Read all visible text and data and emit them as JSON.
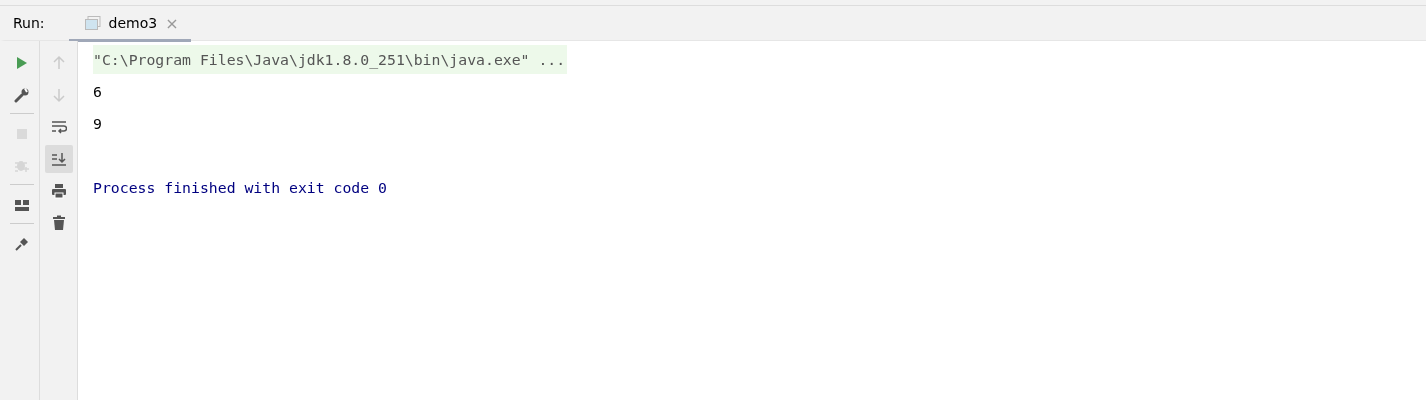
{
  "panel": {
    "label": "Run:"
  },
  "tabs": [
    {
      "label": "demo3",
      "selected": true,
      "close": "×"
    }
  ],
  "left_toolbar": [
    [
      {
        "kind": "run",
        "disabled": false
      },
      {
        "kind": "wrench",
        "disabled": false
      }
    ],
    [
      {
        "kind": "stop",
        "disabled": true
      },
      {
        "kind": "debug",
        "disabled": true
      }
    ],
    [
      {
        "kind": "layout",
        "disabled": false
      }
    ],
    [
      {
        "kind": "pin",
        "disabled": false
      }
    ]
  ],
  "console_toolbar": [
    {
      "kind": "up",
      "disabled": true,
      "selected": false
    },
    {
      "kind": "down",
      "disabled": true,
      "selected": false
    },
    {
      "kind": "wrap",
      "disabled": false,
      "selected": false
    },
    {
      "kind": "scroll-end",
      "disabled": false,
      "selected": true
    },
    {
      "kind": "print",
      "disabled": false,
      "selected": false
    },
    {
      "kind": "trash",
      "disabled": false,
      "selected": false
    }
  ],
  "console": [
    {
      "kind": "command",
      "text": "\"C:\\Program Files\\Java\\jdk1.8.0_251\\bin\\java.exe\" ..."
    },
    {
      "kind": "output",
      "text": "6"
    },
    {
      "kind": "output",
      "text": "9"
    },
    {
      "kind": "blank"
    },
    {
      "kind": "system",
      "text": "Process finished with exit code 0"
    }
  ]
}
